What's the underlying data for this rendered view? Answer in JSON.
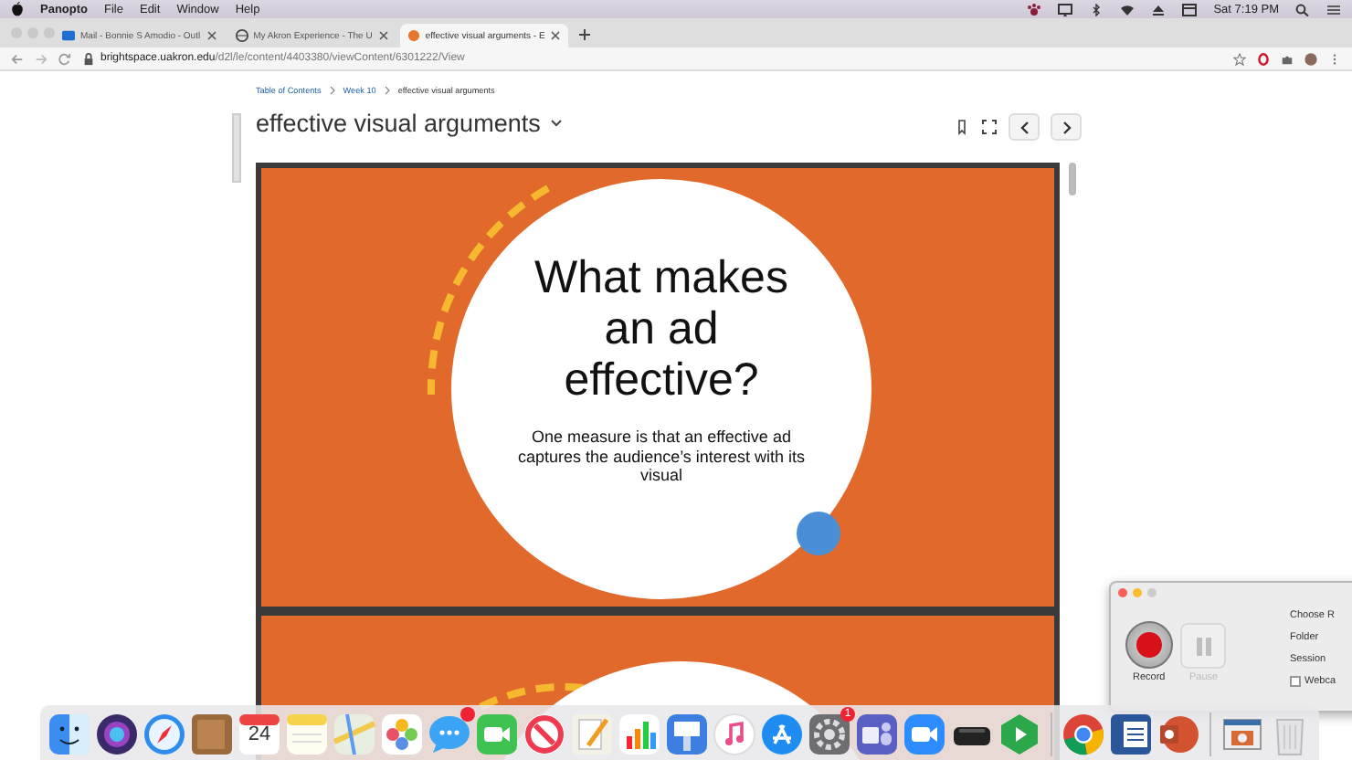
{
  "menu_bar": {
    "app_name": "Panopto",
    "menus": [
      "File",
      "Edit",
      "Window",
      "Help"
    ],
    "clock": "Sat 7:19 PM"
  },
  "tabs": [
    {
      "title": "Mail - Bonnie S Amodio - Outl",
      "selected": false
    },
    {
      "title": "My Akron Experience - The U",
      "selected": false
    },
    {
      "title": "effective visual arguments - E",
      "selected": true
    }
  ],
  "address_bar": {
    "url_host": "brightspace.uakron.edu",
    "url_path": "/d2l/le/content/4403380/viewContent/6301222/View"
  },
  "breadcrumbs": [
    "Table of Contents",
    "Week 10",
    "effective visual arguments"
  ],
  "page_title": "effective visual arguments",
  "slide": {
    "title": "What makes an ad effective?",
    "body": "One measure is that an effective ad captures the audience’s interest with its visual"
  },
  "recorder": {
    "record_label": "Record",
    "pause_label": "Pause",
    "pause_disabled": true,
    "settings": [
      "Choose R",
      "Folder",
      "Session"
    ],
    "webcam": {
      "label": "Webca",
      "checked": false
    }
  },
  "dock": {
    "calendar_day": "24",
    "settings_badge": "1"
  }
}
